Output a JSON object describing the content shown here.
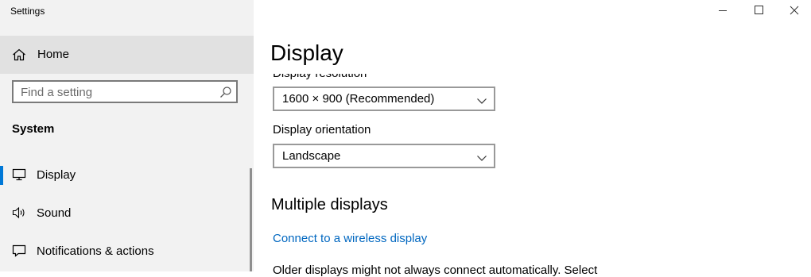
{
  "window": {
    "title": "Settings",
    "controls": {
      "minimize": "minimize-icon",
      "maximize": "maximize-icon",
      "close": "close-icon"
    }
  },
  "sidebar": {
    "home": {
      "label": "Home",
      "icon": "home-icon"
    },
    "search": {
      "placeholder": "Find a setting",
      "value": "",
      "icon": "search-icon"
    },
    "section_label": "System",
    "items": [
      {
        "label": "Display",
        "icon": "monitor-icon",
        "selected": true
      },
      {
        "label": "Sound",
        "icon": "speaker-icon",
        "selected": false
      },
      {
        "label": "Notifications & actions",
        "icon": "notification-icon",
        "selected": false
      }
    ]
  },
  "main": {
    "title": "Display",
    "resolution": {
      "label": "Display resolution",
      "value": "1600 × 900 (Recommended)"
    },
    "orientation": {
      "label": "Display orientation",
      "value": "Landscape"
    },
    "multiple_displays": {
      "heading": "Multiple displays",
      "link": "Connect to a wireless display",
      "description": "Older displays might not always connect automatically. Select"
    }
  },
  "colors": {
    "accent": "#0078d7",
    "link": "#0067c0",
    "sidebar_bg": "#f2f2f2",
    "home_bg": "#e1e1e1"
  }
}
